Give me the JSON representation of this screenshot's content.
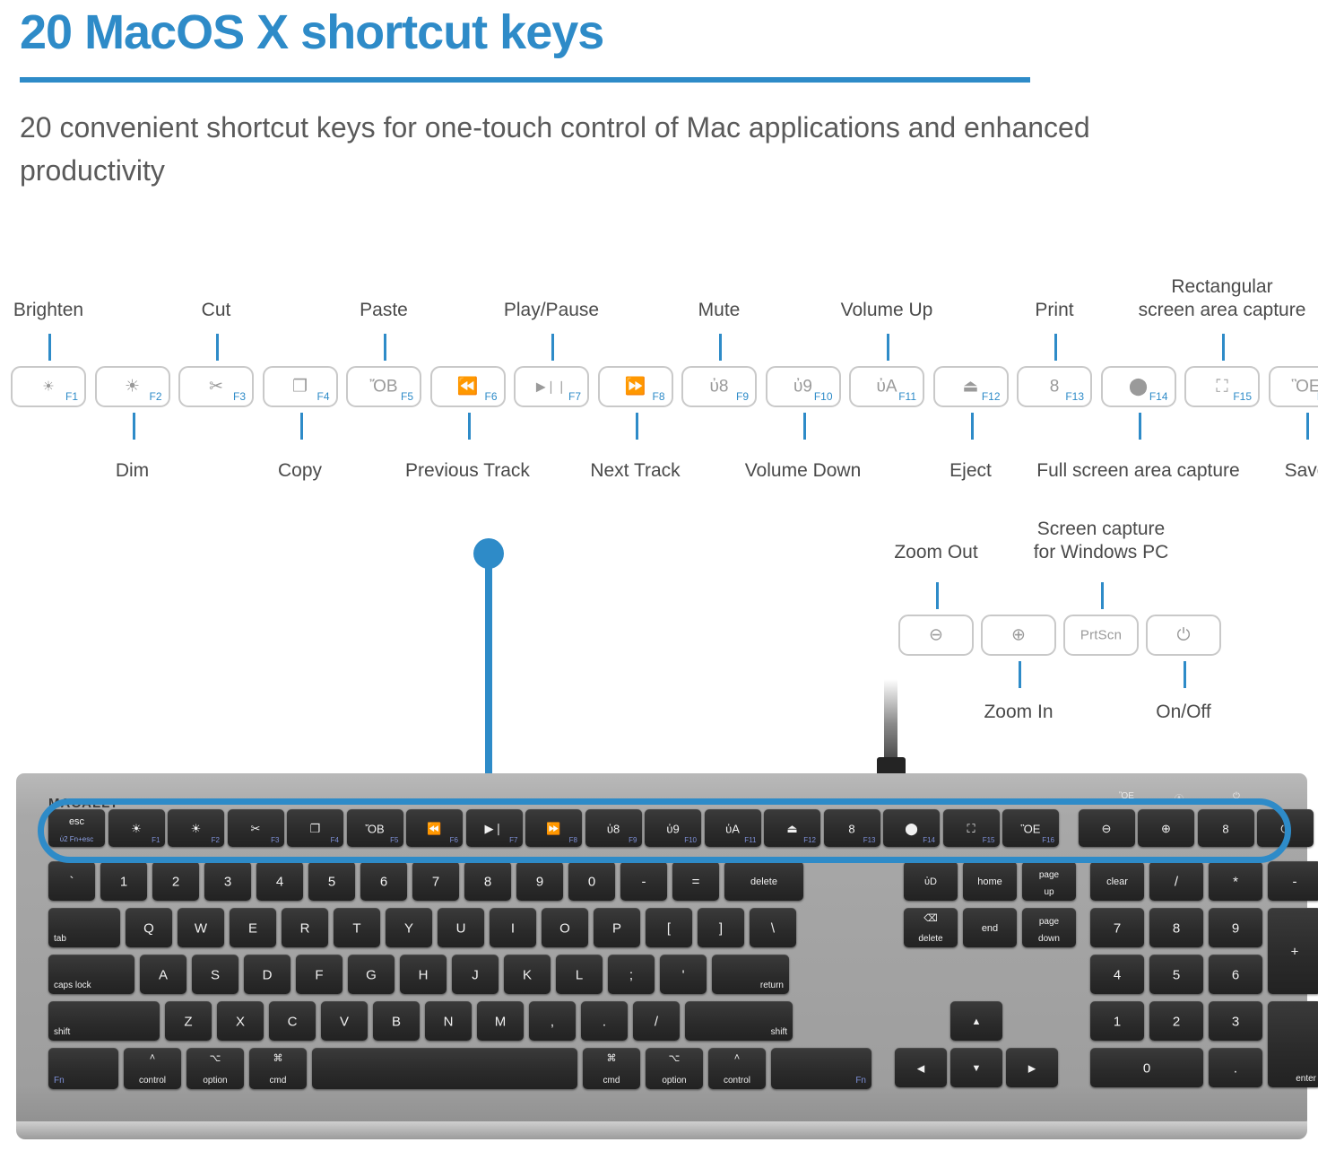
{
  "header": {
    "title": "20 MacOS X shortcut keys",
    "subtitle": "20 convenient shortcut keys for one-touch control of\nMac applications and enhanced productivity",
    "accent_color": "#2E8BC8",
    "text_color": "#5a5a5a"
  },
  "callout_keys": [
    {
      "fn": "F1",
      "glyph": "☀",
      "icon": "brightness-dim-icon",
      "label_above": "Brighten",
      "label_below": ""
    },
    {
      "fn": "F2",
      "glyph": "☀",
      "icon": "brightness-up-icon",
      "label_above": "",
      "label_below": "Dim"
    },
    {
      "fn": "F3",
      "glyph": "✂",
      "icon": "scissors-icon",
      "label_above": "Cut",
      "label_below": ""
    },
    {
      "fn": "F4",
      "glyph": "❐",
      "icon": "copy-icon",
      "label_above": "",
      "label_below": "Copy"
    },
    {
      "fn": "F5",
      "glyph": "ὌB",
      "icon": "paste-icon",
      "label_above": "Paste",
      "label_below": ""
    },
    {
      "fn": "F6",
      "glyph": "⏪",
      "icon": "previous-track-icon",
      "label_above": "",
      "label_below": "Previous Track"
    },
    {
      "fn": "F7",
      "glyph": "▶❘❘",
      "icon": "play-pause-icon",
      "label_above": "Play/Pause",
      "label_below": ""
    },
    {
      "fn": "F8",
      "glyph": "⏩",
      "icon": "next-track-icon",
      "label_above": "",
      "label_below": "Next Track"
    },
    {
      "fn": "F9",
      "glyph": "ὐ8",
      "icon": "mute-icon",
      "label_above": "Mute",
      "label_below": ""
    },
    {
      "fn": "F10",
      "glyph": "ὐ9",
      "icon": "volume-down-icon",
      "label_above": "",
      "label_below": "Volume Down"
    },
    {
      "fn": "F11",
      "glyph": "ὐA",
      "icon": "volume-up-icon",
      "label_above": "Volume Up",
      "label_below": ""
    },
    {
      "fn": "F12",
      "glyph": "⏏",
      "icon": "eject-icon",
      "label_above": "",
      "label_below": "Eject"
    },
    {
      "fn": "F13",
      "glyph": "὚8",
      "icon": "printer-icon",
      "label_above": "Print",
      "label_below": ""
    },
    {
      "fn": "F14",
      "glyph": "⬤",
      "icon": "fullscreen-capture-icon",
      "label_above": "",
      "label_below": "Full screen area capture"
    },
    {
      "fn": "F15",
      "glyph": "⛶",
      "icon": "rectangular-capture-icon",
      "label_above": "Rectangular\nscreen area capture",
      "label_below": ""
    },
    {
      "fn": "F16",
      "glyph": "ὋE",
      "icon": "save-icon",
      "label_above": "",
      "label_below": "Save"
    }
  ],
  "secondary_keys": [
    {
      "text": "",
      "glyph": "⊖",
      "icon": "zoom-out-icon",
      "label_above": "Zoom Out",
      "label_below": ""
    },
    {
      "text": "",
      "glyph": "⊕",
      "icon": "zoom-in-icon",
      "label_above": "",
      "label_below": "Zoom In"
    },
    {
      "text": "PrtScn",
      "glyph": "",
      "icon": "print-screen-key",
      "label_above": "Screen capture\nfor Windows PC",
      "label_below": ""
    },
    {
      "text": "",
      "glyph": "⏻",
      "icon": "power-icon",
      "label_above": "",
      "label_below": "On/Off"
    }
  ],
  "keyboard": {
    "brand": "MACALLY",
    "function_row": [
      {
        "main": "esc",
        "sub": "Fn+esc",
        "fn": ""
      },
      {
        "main": "☀",
        "sub": "",
        "fn": "F1"
      },
      {
        "main": "☀",
        "sub": "",
        "fn": "F2"
      },
      {
        "main": "✂",
        "sub": "",
        "fn": "F3"
      },
      {
        "main": "❐",
        "sub": "",
        "fn": "F4"
      },
      {
        "main": "ὌB",
        "sub": "",
        "fn": "F5"
      },
      {
        "main": "⏪",
        "sub": "",
        "fn": "F6"
      },
      {
        "main": "▶❘",
        "sub": "",
        "fn": "F7"
      },
      {
        "main": "⏩",
        "sub": "",
        "fn": "F8"
      },
      {
        "main": "ὐ8",
        "sub": "",
        "fn": "F9"
      },
      {
        "main": "ὐ9",
        "sub": "",
        "fn": "F10"
      },
      {
        "main": "ὐA",
        "sub": "",
        "fn": "F11"
      },
      {
        "main": "⏏",
        "sub": "",
        "fn": "F12"
      },
      {
        "main": "὚8",
        "sub": "",
        "fn": "F13"
      },
      {
        "main": "⬤",
        "sub": "",
        "fn": "F14"
      },
      {
        "main": "⛶",
        "sub": "",
        "fn": "F15"
      },
      {
        "main": "ὋE",
        "sub": "",
        "fn": "F16"
      },
      {
        "main": "⊖",
        "sub": "",
        "fn": ""
      },
      {
        "main": "⊕",
        "sub": "",
        "fn": ""
      },
      {
        "main": "὚8",
        "sub": "",
        "fn": ""
      },
      {
        "main": "⏻",
        "sub": "",
        "fn": ""
      }
    ],
    "indicators": [
      "ὋE",
      "Ⓐ",
      "⏻"
    ],
    "number_row": [
      "`",
      "1",
      "2",
      "3",
      "4",
      "5",
      "6",
      "7",
      "8",
      "9",
      "0",
      "-",
      "=",
      "delete"
    ],
    "qwerty_row": [
      "tab",
      "Q",
      "W",
      "E",
      "R",
      "T",
      "Y",
      "U",
      "I",
      "O",
      "P",
      "[",
      "]",
      "\\"
    ],
    "asdf_row": [
      "caps lock",
      "A",
      "S",
      "D",
      "F",
      "G",
      "H",
      "J",
      "K",
      "L",
      ";",
      "'",
      "return"
    ],
    "zxcv_row": [
      "shift",
      "Z",
      "X",
      "C",
      "V",
      "B",
      "N",
      "M",
      ",",
      ".",
      "/",
      "shift"
    ],
    "bottom_row_left": [
      "Fn",
      "control",
      "option",
      "cmd"
    ],
    "bottom_row_right": [
      "cmd",
      "option",
      "control",
      "Fn"
    ],
    "nav_cluster": [
      [
        "ὐD",
        "home",
        "page\nup"
      ],
      [
        "delete",
        "end",
        "page\ndown"
      ]
    ],
    "numpad_row1": [
      "clear",
      "/",
      "*",
      "-"
    ],
    "numpad_row2": [
      "7",
      "8",
      "9",
      "+"
    ],
    "numpad_row3": [
      "4",
      "5",
      "6"
    ],
    "numpad_row4": [
      "1",
      "2",
      "3",
      "enter"
    ],
    "numpad_row5": [
      "0",
      "."
    ],
    "arrows": [
      "▲",
      "◀",
      "▼",
      "▶"
    ]
  }
}
